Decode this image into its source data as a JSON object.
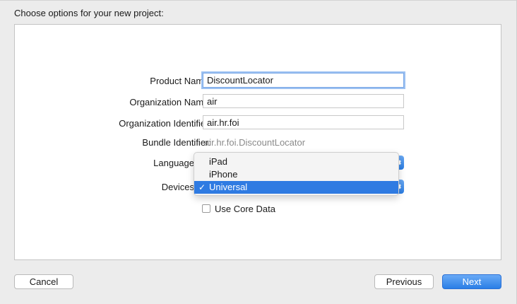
{
  "header": {
    "title": "Choose options for your new project:"
  },
  "form": {
    "product_name": {
      "label": "Product Name:",
      "value": "DiscountLocator"
    },
    "organization_name": {
      "label": "Organization Name:",
      "value": "air"
    },
    "organization_identifier": {
      "label": "Organization Identifier:",
      "value": "air.hr.foi"
    },
    "bundle_identifier": {
      "label": "Bundle Identifier:",
      "value": "air.hr.foi.DiscountLocator"
    },
    "language": {
      "label": "Language"
    },
    "devices": {
      "label": "Devices"
    },
    "use_core_data": {
      "label": "Use Core Data",
      "checked": false
    }
  },
  "devices_menu": {
    "items": [
      {
        "label": "iPad",
        "selected": false
      },
      {
        "label": "iPhone",
        "selected": false
      },
      {
        "label": "Universal",
        "selected": true
      }
    ],
    "check_glyph": "✓"
  },
  "footer": {
    "cancel_label": "Cancel",
    "previous_label": "Previous",
    "next_label": "Next"
  },
  "colors": {
    "accent": "#2f7be2",
    "panel_bg": "#ffffff",
    "window_bg": "#ececec"
  }
}
